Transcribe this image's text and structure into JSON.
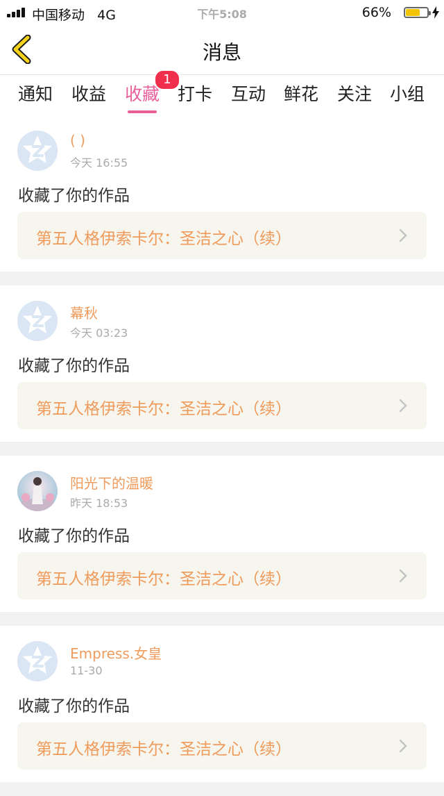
{
  "status_bar": {
    "carrier": "中国移动",
    "network": "4G",
    "time": "下午5:08",
    "battery_percent": "66%",
    "battery_level": 0.66
  },
  "header": {
    "title": "消息"
  },
  "tabs": [
    {
      "label": "通知"
    },
    {
      "label": "收益"
    },
    {
      "label": "收藏",
      "badge": "1"
    },
    {
      "label": "打卡"
    },
    {
      "label": "互动"
    },
    {
      "label": "鲜花"
    },
    {
      "label": "关注"
    },
    {
      "label": "小组"
    }
  ],
  "active_tab": "收藏",
  "colors": {
    "accent": "#e8609a",
    "name_color": "#ef9b5c",
    "badge": "#ef2f4b"
  },
  "notifications": [
    {
      "user": "( )",
      "time": "今天 16:55",
      "action": "收藏了你的作品",
      "work_title": "第五人格伊索卡尔：圣洁之心（续）",
      "avatar": "default-avatar-icon"
    },
    {
      "user": "幕秋",
      "time": "今天 03:23",
      "action": "收藏了你的作品",
      "work_title": "第五人格伊索卡尔：圣洁之心（续）",
      "avatar": "default-avatar-icon"
    },
    {
      "user": "阳光下的温暖",
      "time": "昨天 18:53",
      "action": "收藏了你的作品",
      "work_title": "第五人格伊索卡尔：圣洁之心（续）",
      "avatar": "photo-avatar"
    },
    {
      "user": "Empress.女皇",
      "time": "11-30",
      "action": "收藏了你的作品",
      "work_title": "第五人格伊索卡尔：圣洁之心（续）",
      "avatar": "default-avatar-icon"
    }
  ]
}
